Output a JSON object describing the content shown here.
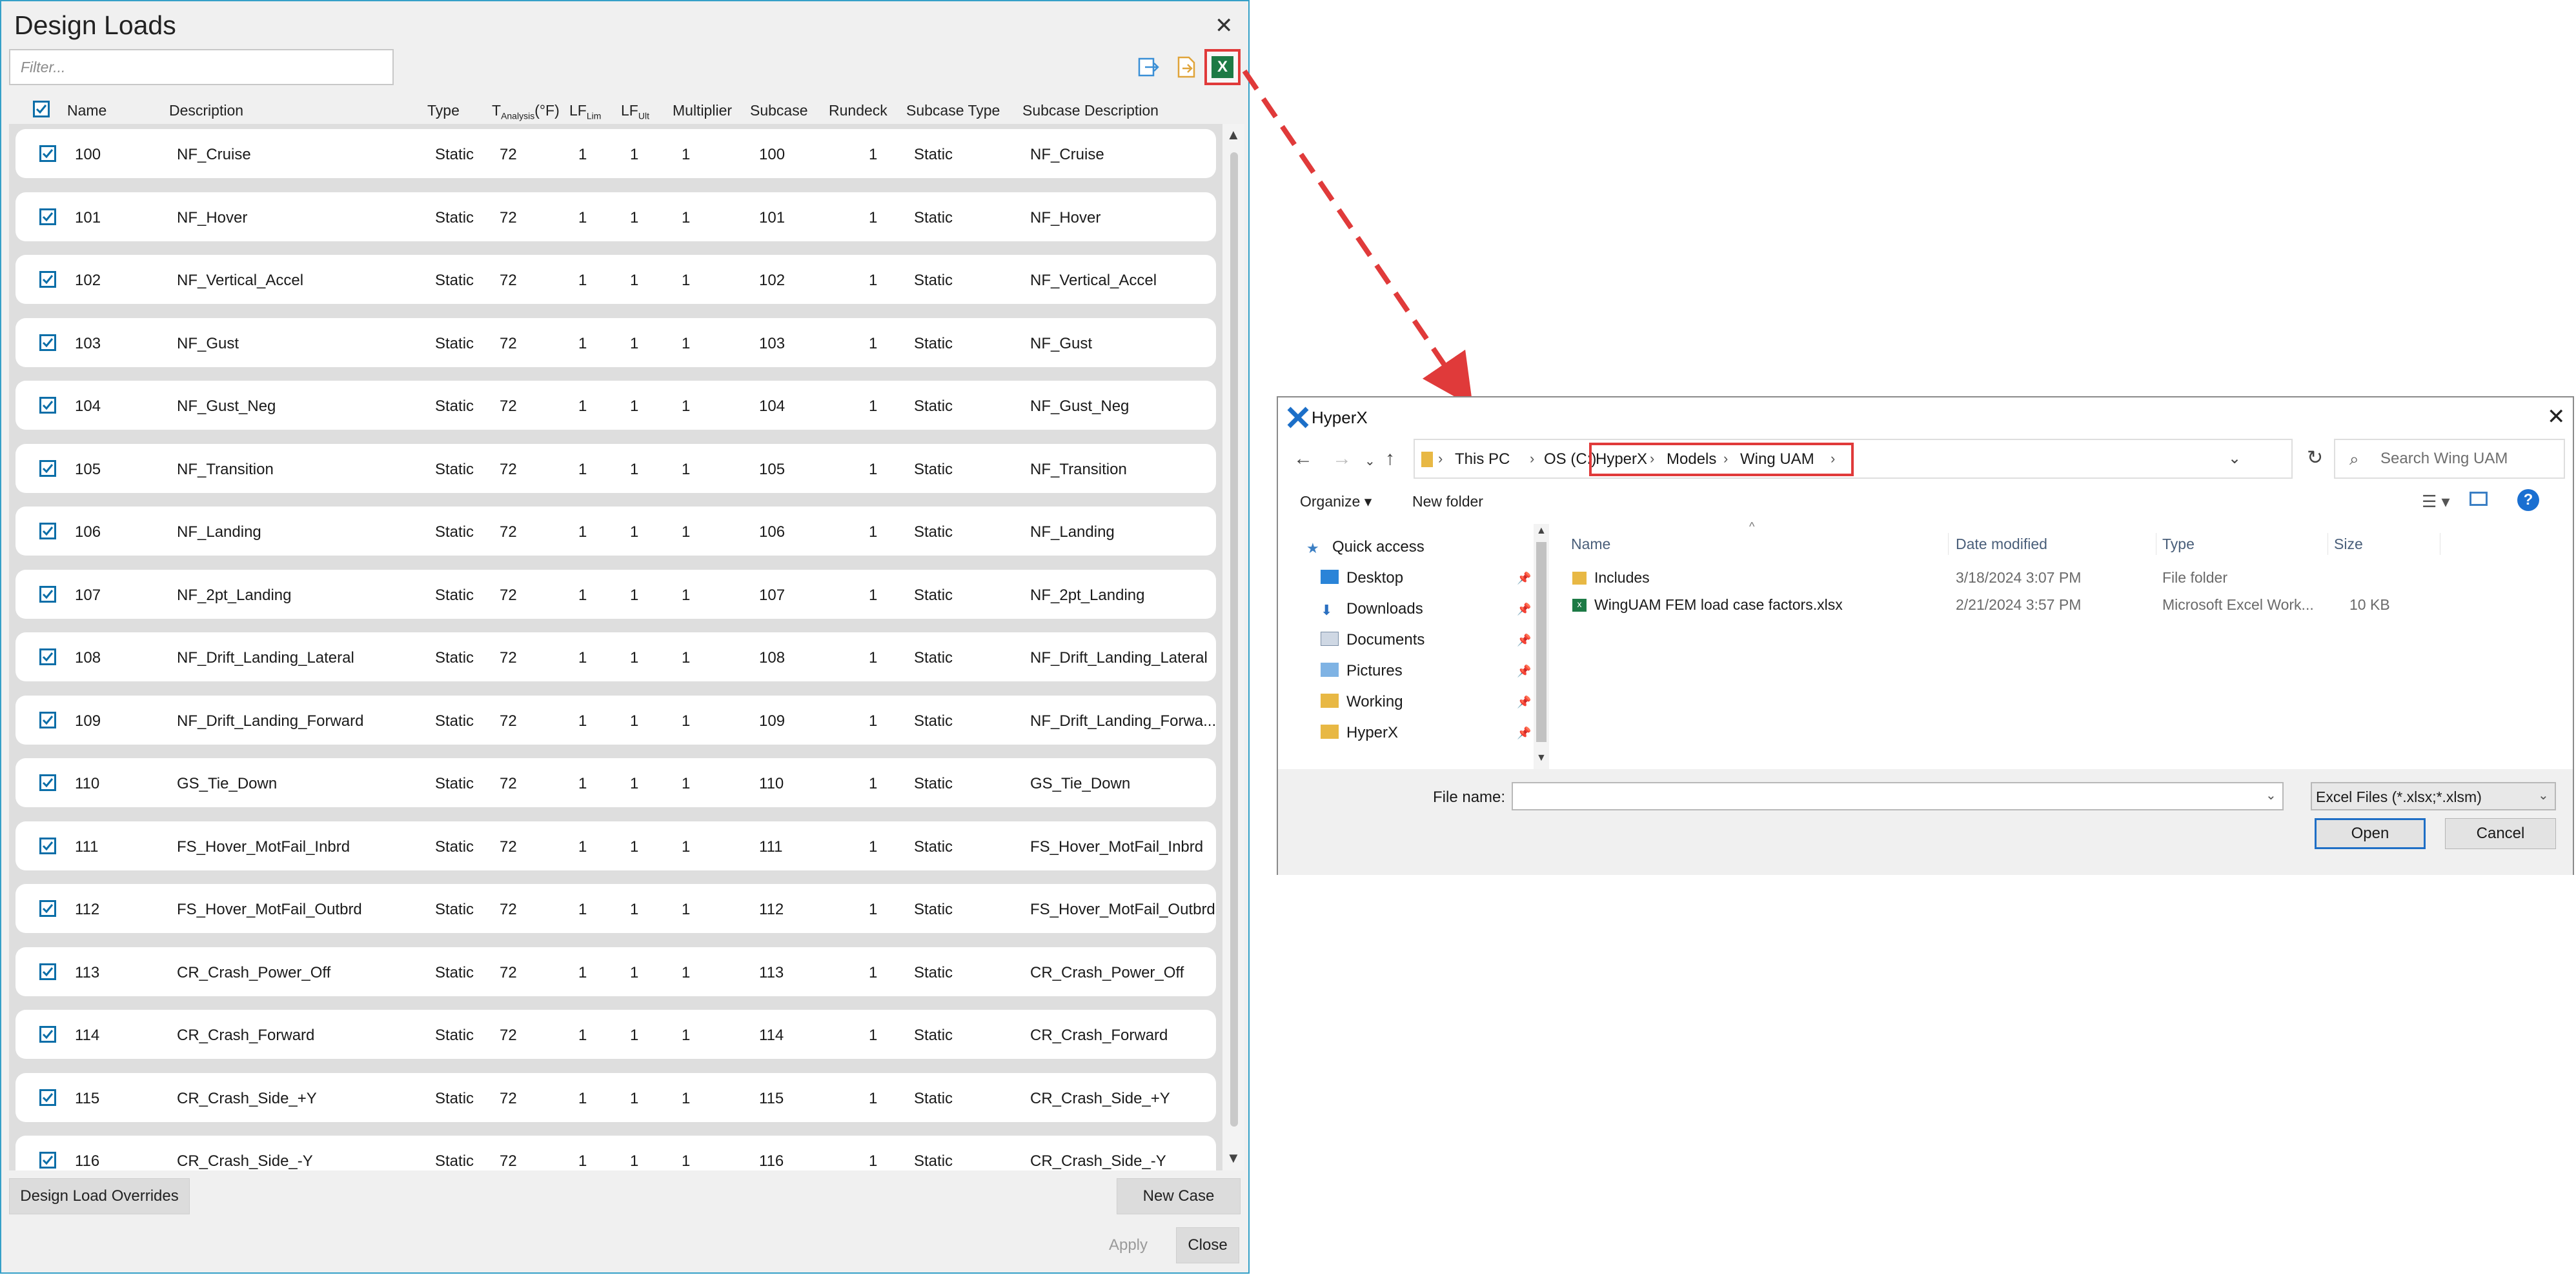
{
  "design_loads": {
    "title": "Design Loads",
    "close_glyph": "✕",
    "filter_placeholder": "Filter...",
    "columns": {
      "name": "Name",
      "description": "Description",
      "type": "Type",
      "t_analysis_main": "T",
      "t_analysis_sub": "Analysis",
      "t_analysis_unit": "(°F)",
      "lf": "LF",
      "lim_sub": "Lim",
      "ult_sub": "Ult",
      "multiplier": "Multiplier",
      "subcase": "Subcase",
      "rundeck": "Rundeck",
      "subcase_type": "Subcase Type",
      "subcase_description": "Subcase Description"
    },
    "rows": [
      {
        "name": "100",
        "description": "NF_Cruise",
        "type": "Static",
        "t": "72",
        "lf_lim": "1",
        "lf_ult": "1",
        "multiplier": "1",
        "subcase": "100",
        "rundeck": "1",
        "subcase_type": "Static",
        "subcase_desc": "NF_Cruise"
      },
      {
        "name": "101",
        "description": "NF_Hover",
        "type": "Static",
        "t": "72",
        "lf_lim": "1",
        "lf_ult": "1",
        "multiplier": "1",
        "subcase": "101",
        "rundeck": "1",
        "subcase_type": "Static",
        "subcase_desc": "NF_Hover"
      },
      {
        "name": "102",
        "description": "NF_Vertical_Accel",
        "type": "Static",
        "t": "72",
        "lf_lim": "1",
        "lf_ult": "1",
        "multiplier": "1",
        "subcase": "102",
        "rundeck": "1",
        "subcase_type": "Static",
        "subcase_desc": "NF_Vertical_Accel"
      },
      {
        "name": "103",
        "description": "NF_Gust",
        "type": "Static",
        "t": "72",
        "lf_lim": "1",
        "lf_ult": "1",
        "multiplier": "1",
        "subcase": "103",
        "rundeck": "1",
        "subcase_type": "Static",
        "subcase_desc": "NF_Gust"
      },
      {
        "name": "104",
        "description": "NF_Gust_Neg",
        "type": "Static",
        "t": "72",
        "lf_lim": "1",
        "lf_ult": "1",
        "multiplier": "1",
        "subcase": "104",
        "rundeck": "1",
        "subcase_type": "Static",
        "subcase_desc": "NF_Gust_Neg"
      },
      {
        "name": "105",
        "description": "NF_Transition",
        "type": "Static",
        "t": "72",
        "lf_lim": "1",
        "lf_ult": "1",
        "multiplier": "1",
        "subcase": "105",
        "rundeck": "1",
        "subcase_type": "Static",
        "subcase_desc": "NF_Transition"
      },
      {
        "name": "106",
        "description": "NF_Landing",
        "type": "Static",
        "t": "72",
        "lf_lim": "1",
        "lf_ult": "1",
        "multiplier": "1",
        "subcase": "106",
        "rundeck": "1",
        "subcase_type": "Static",
        "subcase_desc": "NF_Landing"
      },
      {
        "name": "107",
        "description": "NF_2pt_Landing",
        "type": "Static",
        "t": "72",
        "lf_lim": "1",
        "lf_ult": "1",
        "multiplier": "1",
        "subcase": "107",
        "rundeck": "1",
        "subcase_type": "Static",
        "subcase_desc": "NF_2pt_Landing"
      },
      {
        "name": "108",
        "description": "NF_Drift_Landing_Lateral",
        "type": "Static",
        "t": "72",
        "lf_lim": "1",
        "lf_ult": "1",
        "multiplier": "1",
        "subcase": "108",
        "rundeck": "1",
        "subcase_type": "Static",
        "subcase_desc": "NF_Drift_Landing_Lateral"
      },
      {
        "name": "109",
        "description": "NF_Drift_Landing_Forward",
        "type": "Static",
        "t": "72",
        "lf_lim": "1",
        "lf_ult": "1",
        "multiplier": "1",
        "subcase": "109",
        "rundeck": "1",
        "subcase_type": "Static",
        "subcase_desc": "NF_Drift_Landing_Forwa..."
      },
      {
        "name": "110",
        "description": "GS_Tie_Down",
        "type": "Static",
        "t": "72",
        "lf_lim": "1",
        "lf_ult": "1",
        "multiplier": "1",
        "subcase": "110",
        "rundeck": "1",
        "subcase_type": "Static",
        "subcase_desc": "GS_Tie_Down"
      },
      {
        "name": "111",
        "description": "FS_Hover_MotFail_Inbrd",
        "type": "Static",
        "t": "72",
        "lf_lim": "1",
        "lf_ult": "1",
        "multiplier": "1",
        "subcase": "111",
        "rundeck": "1",
        "subcase_type": "Static",
        "subcase_desc": "FS_Hover_MotFail_Inbrd"
      },
      {
        "name": "112",
        "description": "FS_Hover_MotFail_Outbrd",
        "type": "Static",
        "t": "72",
        "lf_lim": "1",
        "lf_ult": "1",
        "multiplier": "1",
        "subcase": "112",
        "rundeck": "1",
        "subcase_type": "Static",
        "subcase_desc": "FS_Hover_MotFail_Outbrd"
      },
      {
        "name": "113",
        "description": "CR_Crash_Power_Off",
        "type": "Static",
        "t": "72",
        "lf_lim": "1",
        "lf_ult": "1",
        "multiplier": "1",
        "subcase": "113",
        "rundeck": "1",
        "subcase_type": "Static",
        "subcase_desc": "CR_Crash_Power_Off"
      },
      {
        "name": "114",
        "description": "CR_Crash_Forward",
        "type": "Static",
        "t": "72",
        "lf_lim": "1",
        "lf_ult": "1",
        "multiplier": "1",
        "subcase": "114",
        "rundeck": "1",
        "subcase_type": "Static",
        "subcase_desc": "CR_Crash_Forward"
      },
      {
        "name": "115",
        "description": "CR_Crash_Side_+Y",
        "type": "Static",
        "t": "72",
        "lf_lim": "1",
        "lf_ult": "1",
        "multiplier": "1",
        "subcase": "115",
        "rundeck": "1",
        "subcase_type": "Static",
        "subcase_desc": "CR_Crash_Side_+Y"
      },
      {
        "name": "116",
        "description": "CR_Crash_Side_-Y",
        "type": "Static",
        "t": "72",
        "lf_lim": "1",
        "lf_ult": "1",
        "multiplier": "1",
        "subcase": "116",
        "rundeck": "1",
        "subcase_type": "Static",
        "subcase_desc": "CR_Crash_Side_-Y"
      }
    ],
    "buttons": {
      "overrides": "Design Load Overrides",
      "new_case": "New Case",
      "apply": "Apply",
      "close": "Close",
      "excel_glyph": "X"
    },
    "colors": {
      "accent": "#0a6ea8",
      "highlight": "#e03a3a",
      "excel": "#1d7a45"
    }
  },
  "open_dialog": {
    "title": "HyperX",
    "close_glyph": "✕",
    "breadcrumbs": [
      "This PC",
      "OS (C:)",
      "HyperX",
      "Models",
      "Wing UAM"
    ],
    "search_placeholder": "Search Wing UAM",
    "toolbar": {
      "organize": "Organize ▾",
      "new_folder": "New folder",
      "help_glyph": "?"
    },
    "nav_items": [
      {
        "label": "Quick access",
        "icon": "star-icon"
      },
      {
        "label": "Desktop",
        "icon": "desktop-icon"
      },
      {
        "label": "Downloads",
        "icon": "download-icon"
      },
      {
        "label": "Documents",
        "icon": "documents-icon"
      },
      {
        "label": "Pictures",
        "icon": "pictures-icon"
      },
      {
        "label": "Working",
        "icon": "folder-icon"
      },
      {
        "label": "HyperX",
        "icon": "folder-icon"
      }
    ],
    "file_columns": {
      "name": "Name",
      "date_modified": "Date modified",
      "type": "Type",
      "size": "Size"
    },
    "files": [
      {
        "name": "Includes",
        "date": "3/18/2024 3:07 PM",
        "type": "File folder",
        "size": "",
        "icon": "folder-icon"
      },
      {
        "name": "WingUAM FEM load case factors.xlsx",
        "date": "2/21/2024 3:57 PM",
        "type": "Microsoft Excel Work...",
        "size": "10 KB",
        "icon": "excel-file-icon"
      }
    ],
    "file_name_label": "File name:",
    "file_name_value": "",
    "file_type_filter": "Excel Files (*.xlsx;*.xlsm)",
    "open_label": "Open",
    "cancel_label": "Cancel"
  }
}
